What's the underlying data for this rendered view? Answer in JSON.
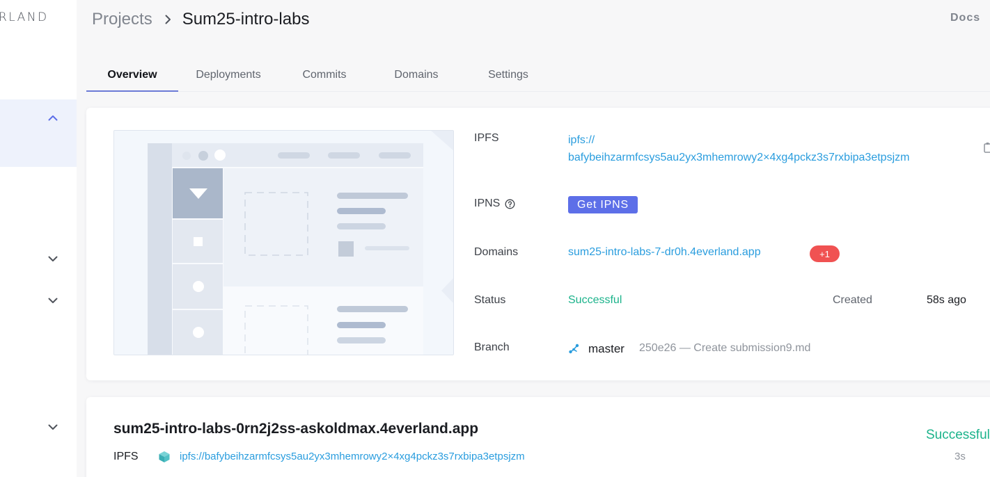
{
  "sidebar": {
    "logo_text": "RLAND"
  },
  "header": {
    "breadcrumb_root": "Projects",
    "breadcrumb_current": "Sum25-intro-labs",
    "docs_label": "Docs"
  },
  "tabs": [
    {
      "label": "Overview",
      "active": true
    },
    {
      "label": "Deployments",
      "active": false
    },
    {
      "label": "Commits",
      "active": false
    },
    {
      "label": "Domains",
      "active": false
    },
    {
      "label": "Settings",
      "active": false
    }
  ],
  "overview": {
    "ipfs_label": "IPFS",
    "ipfs_value": "ipfs://\nbafybeihzarmfcsys5au2yx3mhemrowy2×4xg4pckz3s7rxbipa3etpsjzm",
    "ipns_label": "IPNS",
    "get_ipns_label": "Get IPNS",
    "domains_label": "Domains",
    "domain_value": "sum25-intro-labs-7-dr0h.4everland.app",
    "domain_extra_badge": "+1",
    "status_label": "Status",
    "status_value": "Successful",
    "created_label": "Created",
    "created_value": "58s ago",
    "branch_label": "Branch",
    "branch_name": "master",
    "commit_text": "250e26 — Create submission9.md"
  },
  "deployment": {
    "title": "sum25-intro-labs-0rn2j2ss-askoldmax.4everland.app",
    "ipfs_label": "IPFS",
    "ipfs_link": "ipfs://bafybeihzarmfcsys5au2yx3mhemrowy2×4xg4pckz3s7rxbipa3etpsjzm",
    "status": "Successful",
    "elapsed": "3s"
  },
  "colors": {
    "accent": "#5d6fe8",
    "link": "#2a9dde",
    "success": "#1cb38b",
    "badge_red": "#f05252"
  },
  "icons": [
    "chevron-up-icon",
    "chevron-down-icon",
    "breadcrumb-chevron-icon",
    "help-icon",
    "copy-icon",
    "branch-icon",
    "ipfs-cube-icon"
  ]
}
